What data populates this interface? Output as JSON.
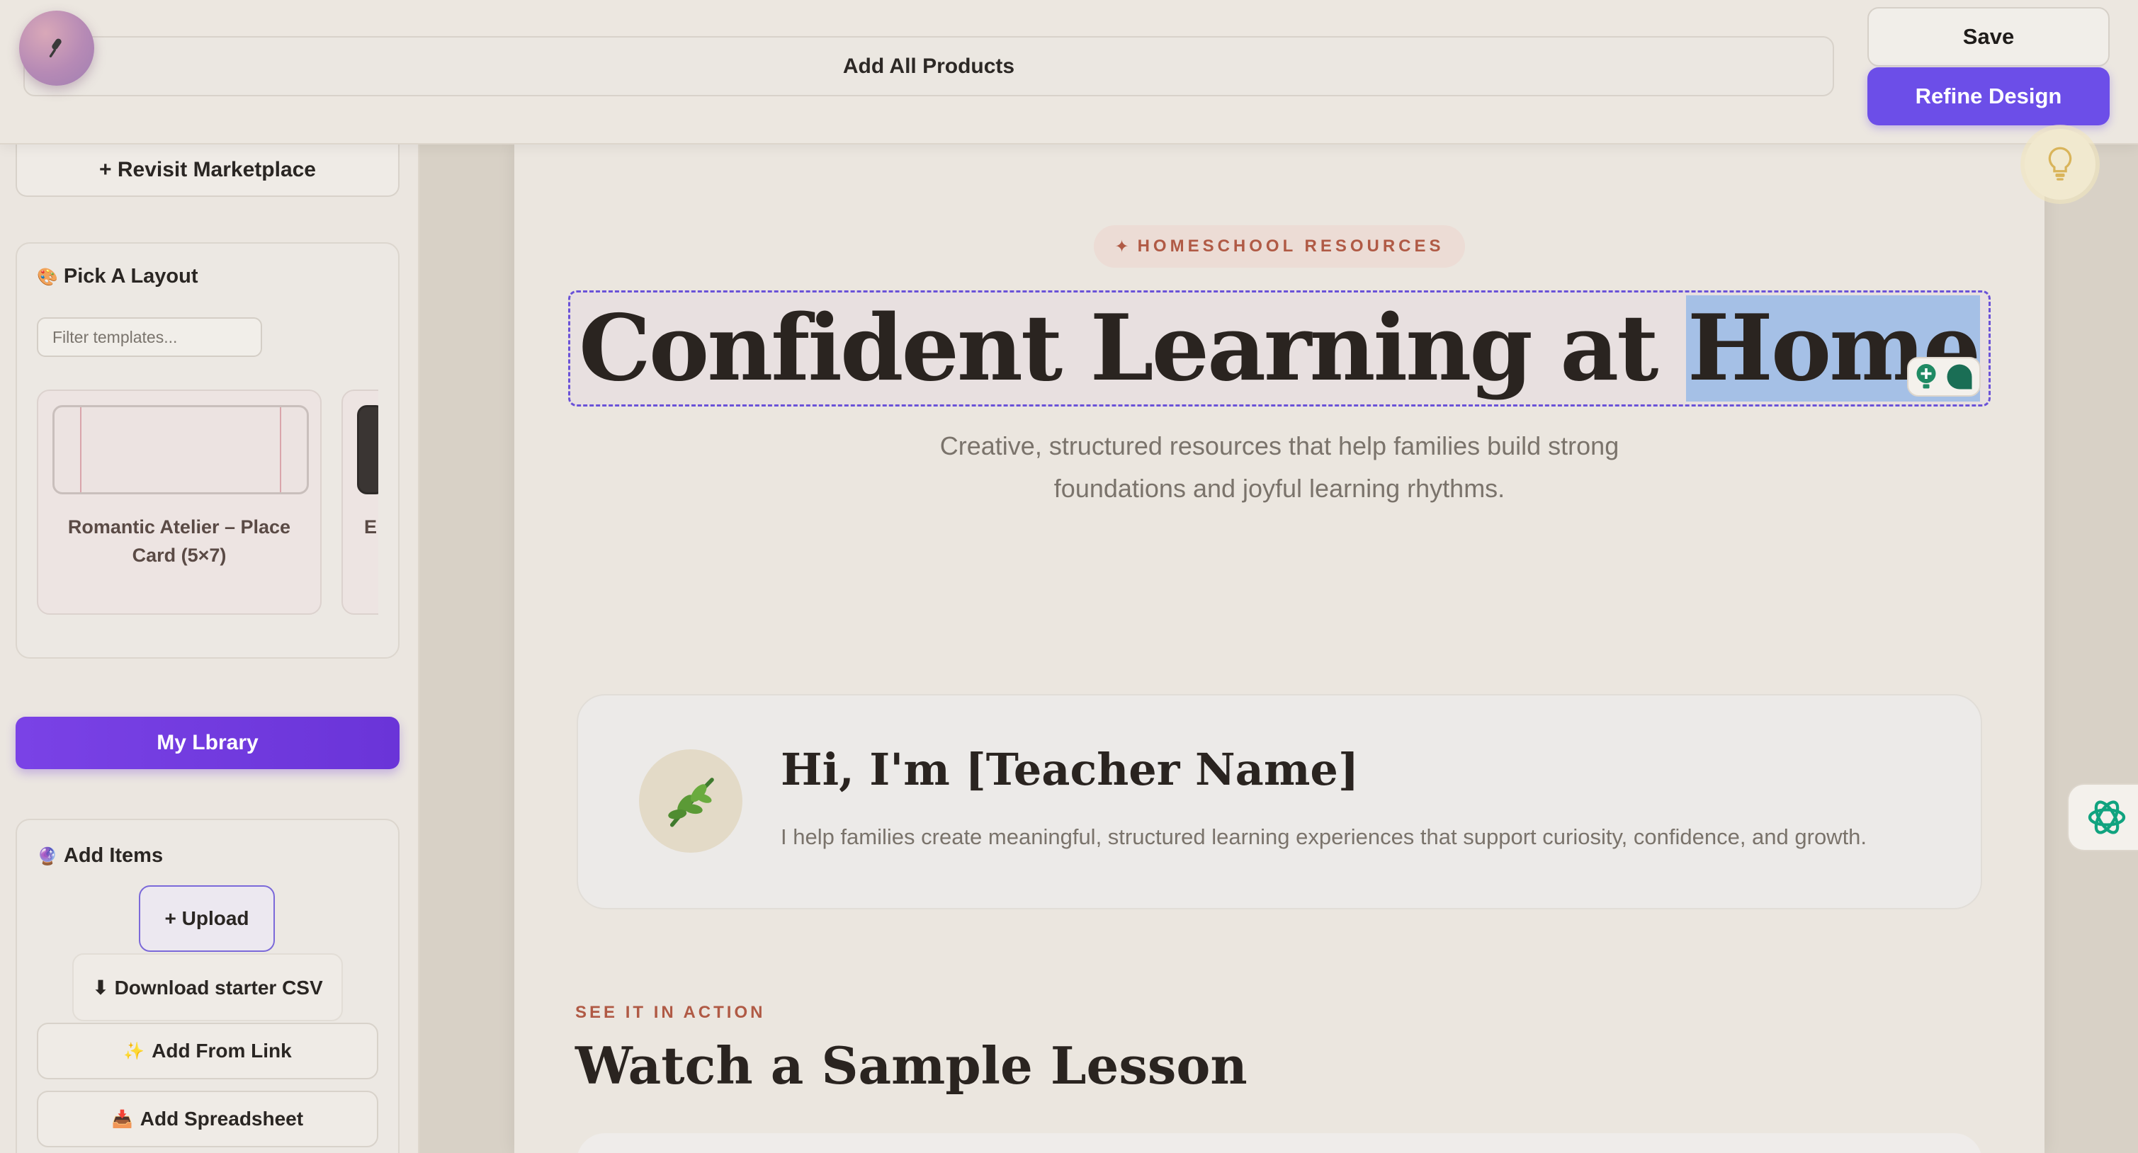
{
  "topbar": {
    "add_all_label": "Add All Products",
    "save_label": "Save",
    "refine_label": "Refine Design"
  },
  "sidebar": {
    "revisit_label": "+ Revisit Marketplace",
    "layout_section": {
      "icon": "palette-icon",
      "title": "Pick A Layout",
      "filter_placeholder": "Filter templates...",
      "templates": [
        {
          "name": "Romantic Atelier – Place Card (5×7)"
        },
        {
          "name": "E… –"
        }
      ]
    },
    "library_label": "My Lbrary",
    "add_items_section": {
      "icon": "crystal-ball-icon",
      "title": "Add Items",
      "upload_label": "+ Upload",
      "download_csv_label": "⬇ Download starter CSV",
      "add_link_label": "Add From Link",
      "add_spreadsheet_label": "Add Spreadsheet"
    }
  },
  "page": {
    "eyebrow_pill": "HOMESCHOOL RESOURCES",
    "hero": {
      "title_prefix": "Confident Learning at ",
      "title_selected": "Home"
    },
    "subtitle_line1": "Creative, structured resources that help families build strong",
    "subtitle_line2": "foundations and joyful learning rhythms.",
    "teacher": {
      "name": "Hi, I'm [Teacher Name]",
      "description": "I help families create meaningful, structured learning experiences that support curiosity, confidence, and growth."
    },
    "sample_section": {
      "eyebrow": "SEE IT IN ACTION",
      "heading": "Watch a Sample Lesson"
    }
  },
  "colors": {
    "accent_purple": "#6c4ee8",
    "accent_terracotta": "#b05a45",
    "selection_blue": "#a5c0e6",
    "ai_green": "#10a37f"
  }
}
